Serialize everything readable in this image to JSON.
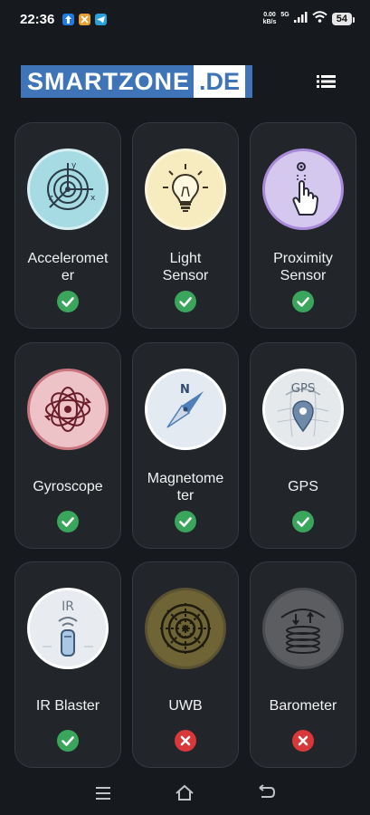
{
  "status_bar": {
    "time": "22:36",
    "net_speed_value": "0.00",
    "net_speed_unit": "kB/s",
    "network_type": "5G",
    "battery": "54"
  },
  "header": {
    "logo_part1": "SMARTZONE",
    "logo_part2": ".DE",
    "menu_icon": "list-icon"
  },
  "sensors": [
    {
      "label": "Acceleromet\ner",
      "icon": "axes-target-icon",
      "supported": true
    },
    {
      "label": "Light\nSensor",
      "icon": "light-bulb-icon",
      "supported": true
    },
    {
      "label": "Proximity\nSensor",
      "icon": "hand-tap-icon",
      "supported": true
    },
    {
      "label": "Gyroscope",
      "icon": "gyroscope-orbit-icon",
      "supported": true
    },
    {
      "label": "Magnetome\nter",
      "icon": "compass-icon",
      "supported": true
    },
    {
      "label": "GPS",
      "icon": "map-pin-icon",
      "icon_text": "GPS",
      "supported": true
    },
    {
      "label": "IR Blaster",
      "icon": "remote-control-icon",
      "icon_text": "IR",
      "supported": true
    },
    {
      "label": "UWB",
      "icon": "radar-icon",
      "supported": false
    },
    {
      "label": "Barometer",
      "icon": "pressure-coil-icon",
      "supported": false
    }
  ],
  "colors": {
    "background": "#16191d",
    "card": "#22262b",
    "ok": "#3aa65c",
    "fail": "#d9383a",
    "brand": "#3f75b8"
  },
  "nav_bar": [
    "menu-icon",
    "home-icon",
    "back-icon"
  ]
}
